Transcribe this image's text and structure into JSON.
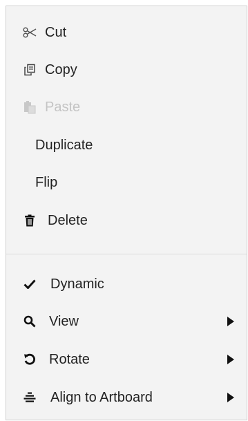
{
  "context_menu": {
    "items": [
      {
        "label": "Cut",
        "icon": "scissors-icon",
        "disabled": false
      },
      {
        "label": "Copy",
        "icon": "copy-icon",
        "disabled": false
      },
      {
        "label": "Paste",
        "icon": "paste-icon",
        "disabled": true
      },
      {
        "label": "Duplicate",
        "icon": "",
        "disabled": false
      },
      {
        "label": "Flip",
        "icon": "",
        "disabled": false
      },
      {
        "label": "Delete",
        "icon": "trash-icon",
        "disabled": false
      },
      {
        "label": "Dynamic",
        "icon": "checkmark-icon",
        "checked": true,
        "disabled": false
      },
      {
        "label": "View",
        "icon": "search-icon",
        "submenu": true,
        "disabled": false
      },
      {
        "label": "Rotate",
        "icon": "rotate-icon",
        "submenu": true,
        "disabled": false
      },
      {
        "label": "Align to Artboard",
        "icon": "align-center-icon",
        "submenu": true,
        "disabled": false
      }
    ]
  },
  "colors": {
    "menu_background": "#f3f3f3",
    "menu_border": "#cfcfcf",
    "text": "#222222",
    "disabled_text": "#c4c4c4",
    "divider": "#d9d9d9"
  }
}
